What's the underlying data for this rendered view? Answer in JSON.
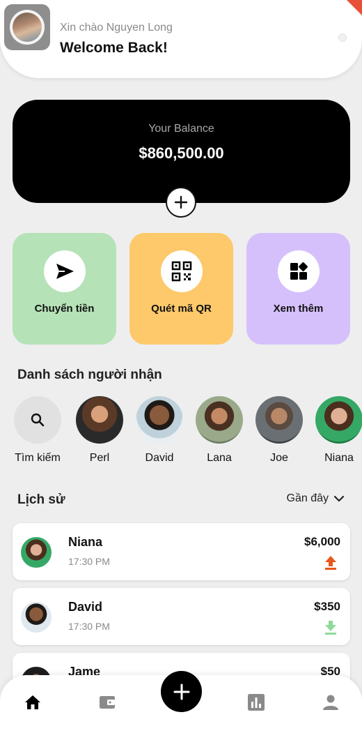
{
  "header": {
    "greeting": "Xin chào Nguyen Long",
    "welcome": "Welcome Back!"
  },
  "balance": {
    "label": "Your Balance",
    "value": "$860,500.00"
  },
  "actions": [
    {
      "label": "Chuyển tiền",
      "icon": "send-icon",
      "color": "#b5e2b7"
    },
    {
      "label": "Quét mã QR",
      "icon": "qr-icon",
      "color": "#fdc96a"
    },
    {
      "label": "Xem thêm",
      "icon": "more-apps-icon",
      "color": "#d5c0fc"
    }
  ],
  "recipients": {
    "title": "Danh sách người nhận",
    "search_label": "Tìm kiếm",
    "people": [
      {
        "name": "Perl"
      },
      {
        "name": "David"
      },
      {
        "name": "Lana"
      },
      {
        "name": "Joe"
      },
      {
        "name": "Niana"
      }
    ]
  },
  "history": {
    "title": "Lịch sử",
    "filter": "Gần đây",
    "items": [
      {
        "name": "Niana",
        "time": "17:30 PM",
        "amount": "$6,000",
        "direction": "up"
      },
      {
        "name": "David",
        "time": "17:30 PM",
        "amount": "$350",
        "direction": "down"
      },
      {
        "name": "Jame",
        "time": "",
        "amount": "$50",
        "direction": ""
      }
    ]
  },
  "colors": {
    "accent_up": "#e8561a",
    "accent_down": "#8fd99a",
    "balance_card": "#000000"
  }
}
